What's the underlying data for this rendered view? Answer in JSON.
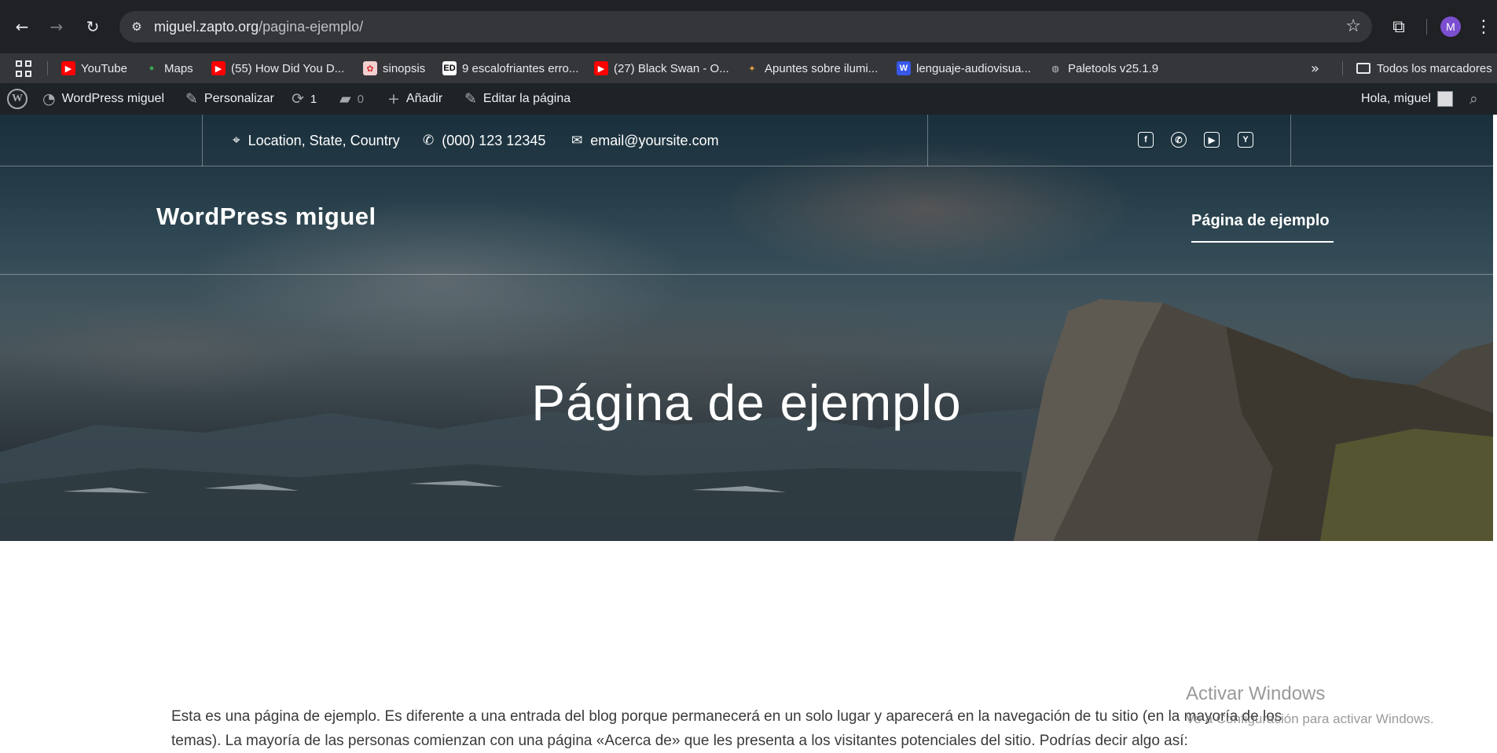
{
  "browser": {
    "url_host": "miguel.zapto.org",
    "url_path": "/pagina-ejemplo/",
    "profile_initial": "M",
    "bookmarks": [
      {
        "label": "YouTube",
        "icon": "youtube-icon"
      },
      {
        "label": "Maps",
        "icon": "maps-icon"
      },
      {
        "label": "(55) How Did You D...",
        "icon": "youtube-icon"
      },
      {
        "label": "sinopsis",
        "icon": "sinopsis-icon"
      },
      {
        "label": "9 escalofriantes erro...",
        "icon": "ed-icon"
      },
      {
        "label": "(27) Black Swan - O...",
        "icon": "youtube-icon"
      },
      {
        "label": "Apuntes sobre ilumi...",
        "icon": "runner-icon"
      },
      {
        "label": "lenguaje-audiovisua...",
        "icon": "wordpress-icon"
      },
      {
        "label": "Paletools v25.1.9",
        "icon": "globe-icon"
      }
    ],
    "all_bookmarks_label": "Todos los marcadores"
  },
  "adminbar": {
    "site_name": "WordPress miguel",
    "customize": "Personalizar",
    "updates_count": "1",
    "comments_count": "0",
    "add_new": "Añadir",
    "edit_page": "Editar la página",
    "greeting": "Hola, miguel"
  },
  "topbar": {
    "location": "Location, State, Country",
    "phone": "(000) 123 12345",
    "email": "email@yoursite.com",
    "social": [
      "facebook-icon",
      "whatsapp-icon",
      "youtube-icon",
      "yelp-icon"
    ]
  },
  "header": {
    "site_title": "WordPress miguel",
    "nav_item": "Página de ejemplo"
  },
  "hero": {
    "page_title": "Página de ejemplo"
  },
  "content": {
    "paragraph": "Esta es una página de ejemplo. Es diferente a una entrada del blog porque permanecerá en un solo lugar y aparecerá en la navegación de tu sitio (en la mayoría de los temas). La mayoría de las personas comienzan con una página «Acerca de» que les presenta a los visitantes potenciales del sitio. Podrías decir algo así:"
  },
  "watermark": {
    "title": "Activar Windows",
    "subtitle": "Ve a Configuración para activar Windows."
  }
}
